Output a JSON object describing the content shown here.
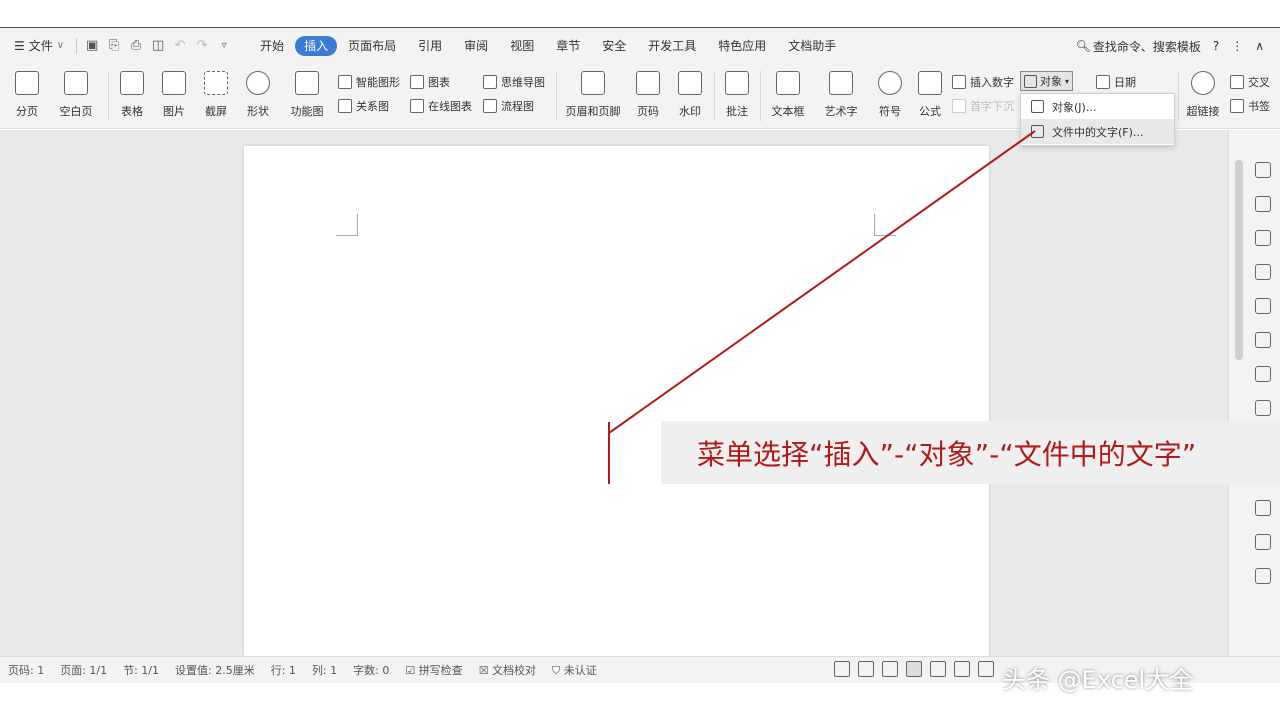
{
  "menubar": {
    "file_label": "文件",
    "tabs": [
      "开始",
      "插入",
      "页面布局",
      "引用",
      "审阅",
      "视图",
      "章节",
      "安全",
      "开发工具",
      "特色应用",
      "文档助手"
    ],
    "active_tab": "插入",
    "search_label": "查找命令、搜索模板"
  },
  "ribbon": {
    "page_break": "分页",
    "blank_page": "空白页",
    "table": "表格",
    "picture": "图片",
    "screenshot": "截屏",
    "shape": "形状",
    "function_chart": "功能图",
    "smart_art": "智能图形",
    "chart": "图表",
    "mind_map": "思维导图",
    "relation_chart": "关系图",
    "online_chart": "在线图表",
    "flow_chart": "流程图",
    "header_footer": "页眉和页脚",
    "page_number": "页码",
    "watermark": "水印",
    "comment": "批注",
    "text_box": "文本框",
    "word_art": "艺术字",
    "symbol": "符号",
    "formula": "公式",
    "insert_number": "插入数字",
    "object": "对象",
    "date": "日期",
    "drop_cap": "首字下沉",
    "hyperlink": "超链接",
    "cross_ref": "交叉",
    "bookmark": "书签"
  },
  "dropdown": {
    "items": [
      "对象(J)...",
      "文件中的文字(F)..."
    ]
  },
  "annotation": {
    "text": "菜单选择“插入”-“对象”-“文件中的文字”"
  },
  "statusbar": {
    "page_num": "页码: 1",
    "pages": "页面: 1/1",
    "section": "节: 1/1",
    "setting": "设置值: 2.5厘米",
    "row": "行: 1",
    "col": "列: 1",
    "words": "字数: 0",
    "spell_check": "拼写检查",
    "doc_proof": "文档校对",
    "uncertified": "未认证"
  },
  "watermark": "头条 @Excel大全",
  "colors": {
    "accent": "#3a7bd5",
    "annotation": "#b01a1a"
  }
}
